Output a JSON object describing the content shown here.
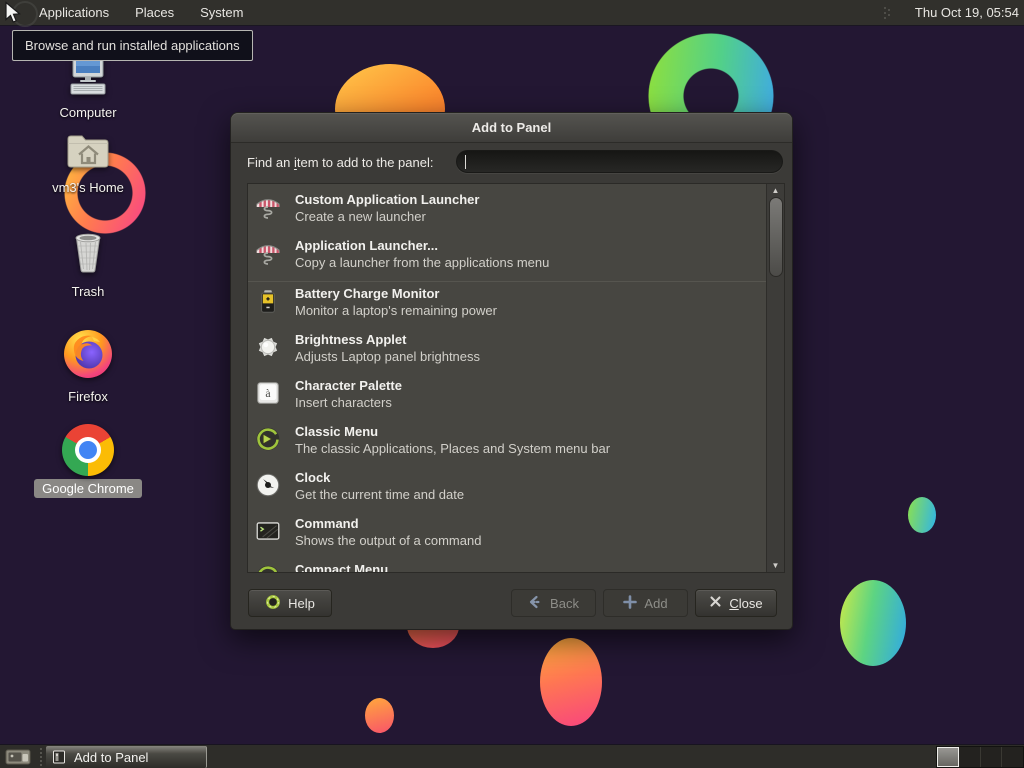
{
  "colors": {
    "desktop_bg": "#231733",
    "panel_bg": "#31302c",
    "dialog_bg": "#3b3a37",
    "accent_green": "#9fc43c",
    "blob_orange": "#ff7c4e",
    "blob_green_blue": "#52d089"
  },
  "top_panel": {
    "menus": [
      {
        "label": "Applications"
      },
      {
        "label": "Places"
      },
      {
        "label": "System"
      }
    ],
    "clock": "Thu Oct 19, 05:54"
  },
  "tooltip": {
    "text": "Browse and run installed applications"
  },
  "desktop": {
    "icons": [
      {
        "label": "Computer",
        "icon": "computer-icon",
        "selected": false
      },
      {
        "label": "vm3's Home",
        "icon": "home-folder-icon",
        "selected": false
      },
      {
        "label": "Trash",
        "icon": "trash-icon",
        "selected": false
      },
      {
        "label": "Firefox",
        "icon": "firefox-icon",
        "selected": false
      },
      {
        "label": "Google Chrome",
        "icon": "chrome-icon",
        "selected": true
      }
    ]
  },
  "dialog": {
    "title": "Add to Panel",
    "find_label": {
      "pre": "Find an ",
      "mnemonic": "i",
      "post": "tem to add to the panel:"
    },
    "search_value": "",
    "items": [
      {
        "title": "Custom Application Launcher",
        "desc": "Create a new launcher",
        "icon": "launcher-icon"
      },
      {
        "title": "Application Launcher...",
        "desc": "Copy a launcher from the applications menu",
        "icon": "launcher-icon"
      },
      {
        "title": "Battery Charge Monitor",
        "desc": "Monitor a laptop's remaining power",
        "icon": "battery-icon"
      },
      {
        "title": "Brightness Applet",
        "desc": "Adjusts Laptop panel brightness",
        "icon": "brightness-icon"
      },
      {
        "title": "Character Palette",
        "desc": "Insert characters",
        "icon": "character-palette-icon"
      },
      {
        "title": "Classic Menu",
        "desc": "The classic Applications, Places and System menu bar",
        "icon": "classic-menu-icon"
      },
      {
        "title": "Clock",
        "desc": "Get the current time and date",
        "icon": "clock-icon"
      },
      {
        "title": "Command",
        "desc": "Shows the output of a command",
        "icon": "command-icon"
      },
      {
        "title": "Compact Menu",
        "desc": "",
        "icon": "compact-menu-icon"
      }
    ],
    "buttons": {
      "help": "Help",
      "back": "Back",
      "add": "Add",
      "close": {
        "mnemonic": "C",
        "post": "lose"
      }
    }
  },
  "taskbar": {
    "window_button": "Add to Panel",
    "workspace_count": 4,
    "active_workspace": 1
  }
}
